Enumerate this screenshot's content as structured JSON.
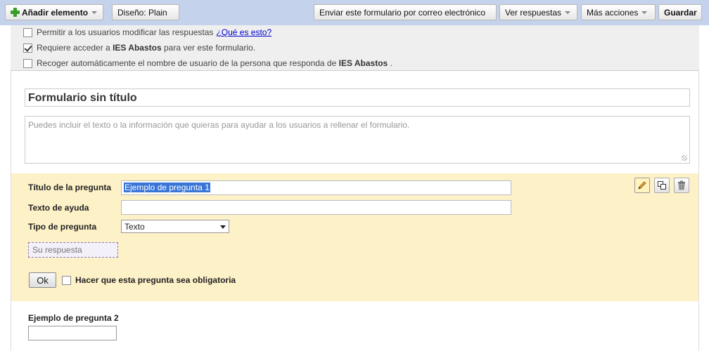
{
  "toolbar": {
    "add_element": "Añadir elemento",
    "design_label": "Diseño:",
    "design_value": "Plain",
    "send_email": "Enviar este formulario por correo electrónico",
    "view_responses": "Ver respuestas",
    "more_actions": "Más acciones",
    "save": "Guardar"
  },
  "options": {
    "allow_modify": "Permitir a los usuarios modificar las respuestas",
    "whats_this": "¿Qué es esto?",
    "require_login_pre": "Requiere acceder a",
    "require_login_org": "IES Abastos",
    "require_login_post": "para ver este formulario.",
    "collect_user_pre": "Recoger automáticamente el nombre de usuario de la persona que responda de",
    "collect_user_org": "IES Abastos",
    "collect_user_post": ".",
    "allow_modify_checked": false,
    "require_login_checked": true,
    "collect_user_checked": false
  },
  "form": {
    "title": "Formulario sin título",
    "description_placeholder": "Puedes incluir el texto o la información que quieras para ayudar a los usuarios a rellenar el formulario."
  },
  "question_editor": {
    "title_label": "Título de la pregunta",
    "title_value": "Ejemplo de pregunta 1",
    "help_label": "Texto de ayuda",
    "help_value": "",
    "type_label": "Tipo de pregunta",
    "type_value": "Texto",
    "answer_preview": "Su respuesta",
    "ok": "Ok",
    "required_label": "Hacer que esta pregunta sea obligatoria",
    "required_checked": false
  },
  "question2": {
    "label": "Ejemplo de pregunta 2"
  }
}
